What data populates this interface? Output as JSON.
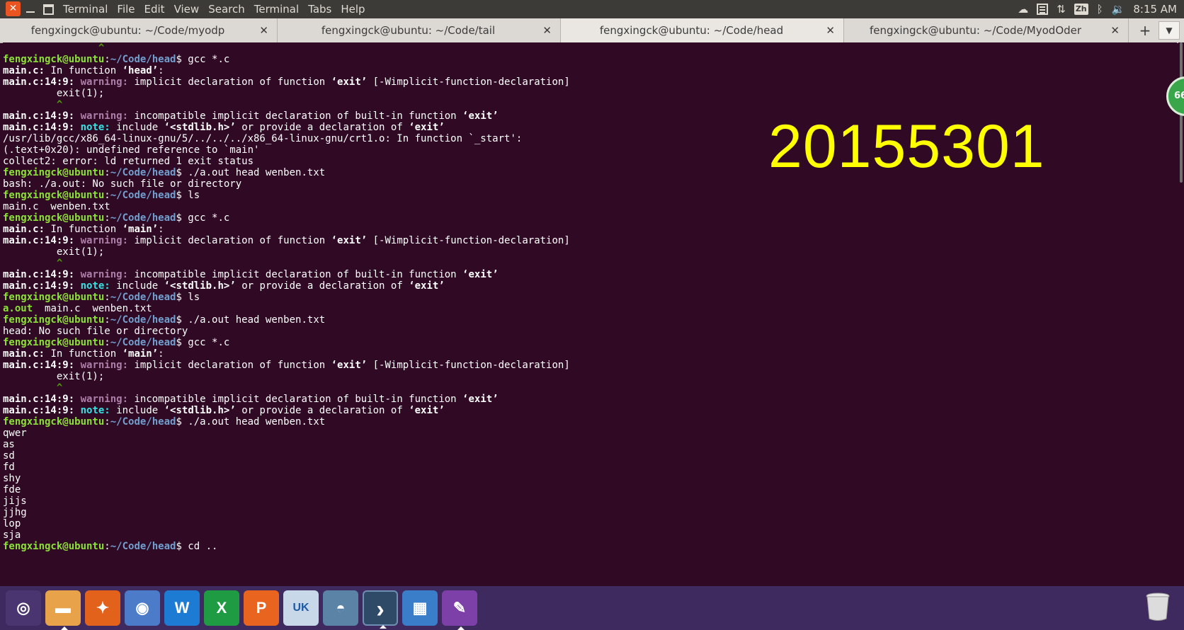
{
  "topbar": {
    "app_name": "Terminal",
    "menus": [
      "File",
      "Edit",
      "View",
      "Search",
      "Terminal",
      "Tabs",
      "Help"
    ],
    "keyboard_indicator": "Zh",
    "clock": "8:15 AM"
  },
  "tabs": [
    {
      "title": "fengxingck@ubuntu: ~/Code/myodp"
    },
    {
      "title": "fengxingck@ubuntu: ~/Code/tail"
    },
    {
      "title": "fengxingck@ubuntu: ~/Code/head"
    },
    {
      "title": "fengxingck@ubuntu: ~/Code/MyodOder"
    }
  ],
  "terminal": {
    "prompt_user": "fengxingck@ubuntu",
    "prompt_path": "~/Code/head",
    "lines": [
      {
        "segs": [
          [
            "                ^",
            "gp"
          ]
        ]
      },
      {
        "segs": [
          [
            "fengxingck@ubuntu",
            "g"
          ],
          [
            ":",
            ""
          ],
          [
            "~/Code/head",
            "bl"
          ],
          [
            "$ gcc *.c",
            ""
          ]
        ]
      },
      {
        "segs": [
          [
            "main.c:",
            "b"
          ],
          [
            " In function ",
            ""
          ],
          [
            "‘head’",
            "b"
          ],
          [
            ":",
            ""
          ]
        ]
      },
      {
        "segs": [
          [
            "main.c:14:9:",
            "b"
          ],
          [
            " ",
            ""
          ],
          [
            "warning:",
            "mg"
          ],
          [
            " implicit declaration of function ",
            ""
          ],
          [
            "‘exit’",
            "b"
          ],
          [
            " [-Wimplicit-function-declaration]",
            ""
          ]
        ]
      },
      {
        "segs": [
          [
            "         exit(1);",
            ""
          ]
        ]
      },
      {
        "segs": [
          [
            "         ^",
            "gp"
          ]
        ]
      },
      {
        "segs": [
          [
            "main.c:14:9:",
            "b"
          ],
          [
            " ",
            ""
          ],
          [
            "warning:",
            "mg"
          ],
          [
            " incompatible implicit declaration of built-in function ",
            ""
          ],
          [
            "‘exit’",
            "b"
          ]
        ]
      },
      {
        "segs": [
          [
            "main.c:14:9:",
            "b"
          ],
          [
            " ",
            ""
          ],
          [
            "note:",
            "cy"
          ],
          [
            " include ",
            ""
          ],
          [
            "‘<stdlib.h>’",
            "b"
          ],
          [
            " or provide a declaration of ",
            ""
          ],
          [
            "‘exit’",
            "b"
          ]
        ]
      },
      {
        "segs": [
          [
            "/usr/lib/gcc/x86_64-linux-gnu/5/../../../x86_64-linux-gnu/crt1.o: In function `_start':",
            ""
          ]
        ]
      },
      {
        "segs": [
          [
            "(.text+0x20): undefined reference to `main'",
            ""
          ]
        ]
      },
      {
        "segs": [
          [
            "collect2: error: ld returned 1 exit status",
            ""
          ]
        ]
      },
      {
        "segs": [
          [
            "fengxingck@ubuntu",
            "g"
          ],
          [
            ":",
            ""
          ],
          [
            "~/Code/head",
            "bl"
          ],
          [
            "$ ./a.out head wenben.txt",
            ""
          ]
        ]
      },
      {
        "segs": [
          [
            "bash: ./a.out: No such file or directory",
            ""
          ]
        ]
      },
      {
        "segs": [
          [
            "fengxingck@ubuntu",
            "g"
          ],
          [
            ":",
            ""
          ],
          [
            "~/Code/head",
            "bl"
          ],
          [
            "$ ls",
            ""
          ]
        ]
      },
      {
        "segs": [
          [
            "main.c  wenben.txt",
            ""
          ]
        ]
      },
      {
        "segs": [
          [
            "fengxingck@ubuntu",
            "g"
          ],
          [
            ":",
            ""
          ],
          [
            "~/Code/head",
            "bl"
          ],
          [
            "$ gcc *.c",
            ""
          ]
        ]
      },
      {
        "segs": [
          [
            "main.c:",
            "b"
          ],
          [
            " In function ",
            ""
          ],
          [
            "‘main’",
            "b"
          ],
          [
            ":",
            ""
          ]
        ]
      },
      {
        "segs": [
          [
            "main.c:14:9:",
            "b"
          ],
          [
            " ",
            ""
          ],
          [
            "warning:",
            "mg"
          ],
          [
            " implicit declaration of function ",
            ""
          ],
          [
            "‘exit’",
            "b"
          ],
          [
            " [-Wimplicit-function-declaration]",
            ""
          ]
        ]
      },
      {
        "segs": [
          [
            "         exit(1);",
            ""
          ]
        ]
      },
      {
        "segs": [
          [
            "         ^",
            "gp"
          ]
        ]
      },
      {
        "segs": [
          [
            "main.c:14:9:",
            "b"
          ],
          [
            " ",
            ""
          ],
          [
            "warning:",
            "mg"
          ],
          [
            " incompatible implicit declaration of built-in function ",
            ""
          ],
          [
            "‘exit’",
            "b"
          ]
        ]
      },
      {
        "segs": [
          [
            "main.c:14:9:",
            "b"
          ],
          [
            " ",
            ""
          ],
          [
            "note:",
            "cy"
          ],
          [
            " include ",
            ""
          ],
          [
            "‘<stdlib.h>’",
            "b"
          ],
          [
            " or provide a declaration of ",
            ""
          ],
          [
            "‘exit’",
            "b"
          ]
        ]
      },
      {
        "segs": [
          [
            "fengxingck@ubuntu",
            "g"
          ],
          [
            ":",
            ""
          ],
          [
            "~/Code/head",
            "bl"
          ],
          [
            "$ ls",
            ""
          ]
        ]
      },
      {
        "segs": [
          [
            "a.out",
            "g"
          ],
          [
            "  main.c  wenben.txt",
            ""
          ]
        ]
      },
      {
        "segs": [
          [
            "fengxingck@ubuntu",
            "g"
          ],
          [
            ":",
            ""
          ],
          [
            "~/Code/head",
            "bl"
          ],
          [
            "$ ./a.out head wenben.txt",
            ""
          ]
        ]
      },
      {
        "segs": [
          [
            "head: No such file or directory",
            ""
          ]
        ]
      },
      {
        "segs": [
          [
            "fengxingck@ubuntu",
            "g"
          ],
          [
            ":",
            ""
          ],
          [
            "~/Code/head",
            "bl"
          ],
          [
            "$ gcc *.c",
            ""
          ]
        ]
      },
      {
        "segs": [
          [
            "main.c:",
            "b"
          ],
          [
            " In function ",
            ""
          ],
          [
            "‘main’",
            "b"
          ],
          [
            ":",
            ""
          ]
        ]
      },
      {
        "segs": [
          [
            "main.c:14:9:",
            "b"
          ],
          [
            " ",
            ""
          ],
          [
            "warning:",
            "mg"
          ],
          [
            " implicit declaration of function ",
            ""
          ],
          [
            "‘exit’",
            "b"
          ],
          [
            " [-Wimplicit-function-declaration]",
            ""
          ]
        ]
      },
      {
        "segs": [
          [
            "         exit(1);",
            ""
          ]
        ]
      },
      {
        "segs": [
          [
            "         ^",
            "gp"
          ]
        ]
      },
      {
        "segs": [
          [
            "main.c:14:9:",
            "b"
          ],
          [
            " ",
            ""
          ],
          [
            "warning:",
            "mg"
          ],
          [
            " incompatible implicit declaration of built-in function ",
            ""
          ],
          [
            "‘exit’",
            "b"
          ]
        ]
      },
      {
        "segs": [
          [
            "main.c:14:9:",
            "b"
          ],
          [
            " ",
            ""
          ],
          [
            "note:",
            "cy"
          ],
          [
            " include ",
            ""
          ],
          [
            "‘<stdlib.h>’",
            "b"
          ],
          [
            " or provide a declaration of ",
            ""
          ],
          [
            "‘exit’",
            "b"
          ]
        ]
      },
      {
        "segs": [
          [
            "fengxingck@ubuntu",
            "g"
          ],
          [
            ":",
            ""
          ],
          [
            "~/Code/head",
            "bl"
          ],
          [
            "$ ./a.out head wenben.txt",
            ""
          ]
        ]
      },
      {
        "segs": [
          [
            "qwer",
            ""
          ]
        ]
      },
      {
        "segs": [
          [
            "as",
            ""
          ]
        ]
      },
      {
        "segs": [
          [
            "sd",
            ""
          ]
        ]
      },
      {
        "segs": [
          [
            "fd",
            ""
          ]
        ]
      },
      {
        "segs": [
          [
            "shy",
            ""
          ]
        ]
      },
      {
        "segs": [
          [
            "fde",
            ""
          ]
        ]
      },
      {
        "segs": [
          [
            "jijs",
            ""
          ]
        ]
      },
      {
        "segs": [
          [
            "jjhg",
            ""
          ]
        ]
      },
      {
        "segs": [
          [
            "lop",
            ""
          ]
        ]
      },
      {
        "segs": [
          [
            "sja",
            ""
          ]
        ]
      },
      {
        "segs": [
          [
            "fengxingck@ubuntu",
            "g"
          ],
          [
            ":",
            ""
          ],
          [
            "~/Code/head",
            "bl"
          ],
          [
            "$ cd ..",
            ""
          ]
        ]
      }
    ]
  },
  "overlay": {
    "student_id": "20155301",
    "badge_text": "66"
  },
  "dock": {
    "items": [
      {
        "name": "ubuntu-logo-icon",
        "glyph": "◎",
        "bg": "#4a3570",
        "running": false
      },
      {
        "name": "files-icon",
        "glyph": "▬",
        "bg": "#e8a34a",
        "running": true
      },
      {
        "name": "firefox-icon",
        "glyph": "✦",
        "bg": "#e2621b",
        "running": false
      },
      {
        "name": "chromium-icon",
        "glyph": "◉",
        "bg": "#4c7cc9",
        "running": false
      },
      {
        "name": "writer-icon",
        "glyph": "W",
        "bg": "#1e7bd4",
        "running": false
      },
      {
        "name": "calc-icon",
        "glyph": "X",
        "bg": "#1f9b44",
        "running": false
      },
      {
        "name": "impress-icon",
        "glyph": "P",
        "bg": "#e8641f",
        "running": false
      },
      {
        "name": "software-center-icon",
        "glyph": "UK",
        "bg": "#c9d8e8",
        "running": false
      },
      {
        "name": "amazon-icon",
        "glyph": "◓",
        "bg": "#5a83a6",
        "running": false
      },
      {
        "name": "terminal-icon",
        "glyph": "›",
        "bg": "#2f4a66",
        "running": true
      },
      {
        "name": "workspace-switcher-icon",
        "glyph": "▦",
        "bg": "#3a7dc9",
        "running": false
      },
      {
        "name": "text-editor-icon",
        "glyph": "✎",
        "bg": "#7d3fa8",
        "running": true
      }
    ]
  },
  "colors": {
    "terminal_bg": "#300a24",
    "prompt_user": "#8ae234",
    "prompt_path": "#729fcf",
    "warning": "#ad7fa8",
    "note": "#34e2e2",
    "overlay_text": "#ffff00"
  }
}
